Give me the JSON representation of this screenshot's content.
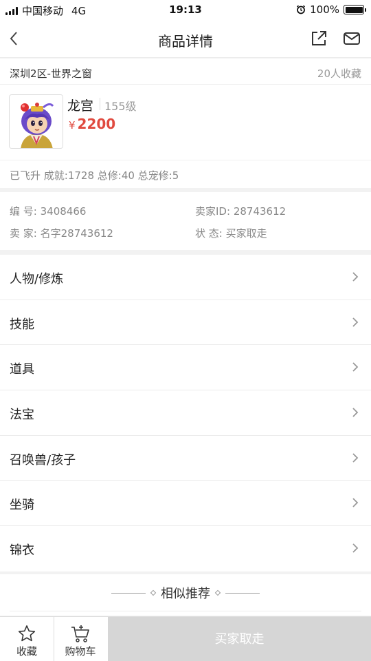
{
  "status_bar": {
    "carrier": "中国移动",
    "network": "4G",
    "time": "19:13",
    "battery": "100%",
    "alarm_icon": "alarm-clock-icon"
  },
  "nav": {
    "title": "商品详情",
    "back_icon": "chevron-left-icon",
    "share_icon": "share-icon",
    "mail_icon": "mail-icon"
  },
  "listing": {
    "server": "深圳2区-世界之窗",
    "favorites": "20人收藏",
    "role_name": "龙宫",
    "level": "155级",
    "currency": "¥",
    "price": "2200",
    "stats": "已飞升 成就:1728 总修:40 总宠修:5"
  },
  "info": {
    "id_key": "编 号:",
    "id_value": "3408466",
    "seller_id_key": "卖家ID:",
    "seller_id_value": "28743612",
    "seller_key": "卖 家:",
    "seller_value": "名字28743612",
    "status_key": "状 态:",
    "status_value": "买家取走"
  },
  "menu": [
    {
      "label": "人物/修炼"
    },
    {
      "label": "技能"
    },
    {
      "label": "道具"
    },
    {
      "label": "法宝"
    },
    {
      "label": "召唤兽/孩子"
    },
    {
      "label": "坐骑"
    },
    {
      "label": "锦衣"
    }
  ],
  "similar": {
    "title": "相似推荐"
  },
  "bottom_bar": {
    "favorite_label": "收藏",
    "cart_label": "购物车",
    "buy_label": "买家取走"
  },
  "colors": {
    "price": "#e04a3f",
    "disabled_button": "#d6d6d6",
    "page_bg": "#f2f2f2"
  }
}
